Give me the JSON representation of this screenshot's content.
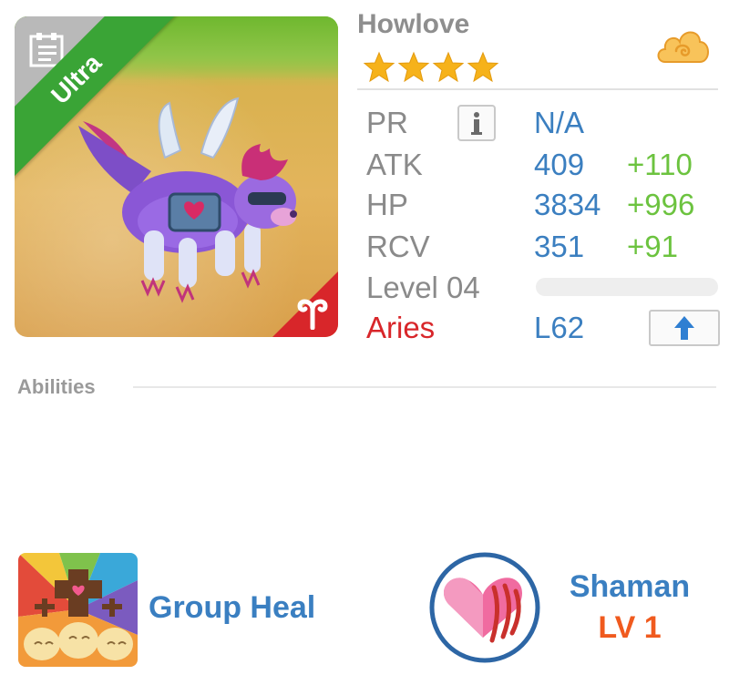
{
  "monster": {
    "name": "Howlove",
    "rarity": "Ultra",
    "stars": 4,
    "sign": "Aries",
    "sign_level": "L62",
    "level_label": "Level 04",
    "level_progress": 0
  },
  "stats": [
    {
      "label": "PR",
      "value": "N/A",
      "bonus": ""
    },
    {
      "label": "ATK",
      "value": "409",
      "bonus": "+110"
    },
    {
      "label": "HP",
      "value": "3834",
      "bonus": "+996"
    },
    {
      "label": "RCV",
      "value": "351",
      "bonus": "+91"
    }
  ],
  "abilities": {
    "title": "Abilities",
    "items": [
      {
        "name": "Group Heal",
        "icon": "group-heal-icon"
      },
      {
        "name": "Shaman",
        "level": "LV 1",
        "icon": "shaman-heart-claw-icon"
      }
    ]
  },
  "icons": {
    "info": "info-icon",
    "level_up": "up-arrow-icon",
    "currency": "cloud-icon",
    "document": "document-icon"
  },
  "colors": {
    "stat_value": "#3b7fc0",
    "stat_bonus": "#6cc33f",
    "sign": "#d8262a",
    "rarity_ribbon": "#3aa436",
    "shaman_level": "#f05a1e"
  }
}
